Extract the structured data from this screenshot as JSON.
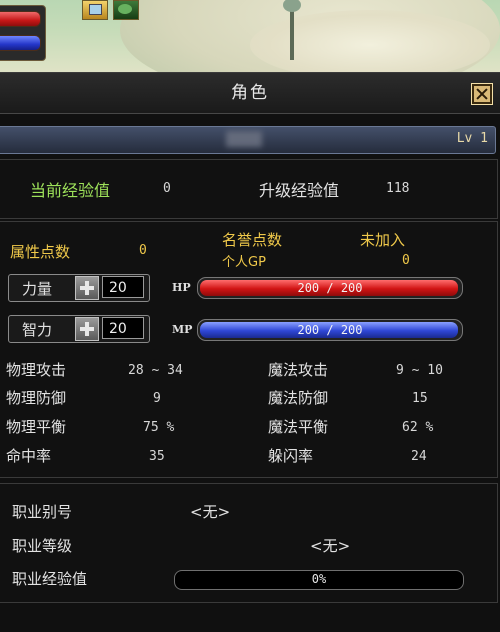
{
  "colors": {
    "hp_bar": "#d11414",
    "mp_bar": "#2f47d6",
    "label_green": "#9ee25a",
    "label_gold": "#f0c94a",
    "close_button": "#d9b977"
  },
  "window": {
    "title": "角色",
    "close_icon": "close-icon",
    "level": "Lv 1"
  },
  "experience": {
    "current_label": "当前经验值",
    "current_value": "0",
    "next_label": "升级经验值",
    "next_value": "118"
  },
  "attributes": {
    "points_label": "属性点数",
    "points_value": "0",
    "honor_label": "名誉点数",
    "honor_value": "未加入",
    "gp_label": "个人GP",
    "gp_value": "0",
    "strength": {
      "label": "力量",
      "value": "20",
      "plus_icon": "plus-icon"
    },
    "intelligence": {
      "label": "智力",
      "value": "20",
      "plus_icon": "plus-icon"
    },
    "hp": {
      "tag": "HP",
      "text": "200 / 200",
      "fraction": 1.0
    },
    "mp": {
      "tag": "MP",
      "text": "200 / 200",
      "fraction": 1.0
    }
  },
  "stats": {
    "left": [
      {
        "label": "物理攻击",
        "value": "28 ~ 34"
      },
      {
        "label": "物理防御",
        "value": "9"
      },
      {
        "label": "物理平衡",
        "value": "75 %"
      },
      {
        "label": "命中率",
        "value": "35"
      }
    ],
    "right": [
      {
        "label": "魔法攻击",
        "value": "9 ~ 10"
      },
      {
        "label": "魔法防御",
        "value": "15"
      },
      {
        "label": "魔法平衡",
        "value": "62 %"
      },
      {
        "label": "躲闪率",
        "value": "24"
      }
    ]
  },
  "job": {
    "alias_label": "职业别号",
    "alias_value": "<无>",
    "grade_label": "职业等级",
    "grade_value": "<无>",
    "exp_label": "职业经验值",
    "exp_text": "0%",
    "exp_fraction": 0
  }
}
